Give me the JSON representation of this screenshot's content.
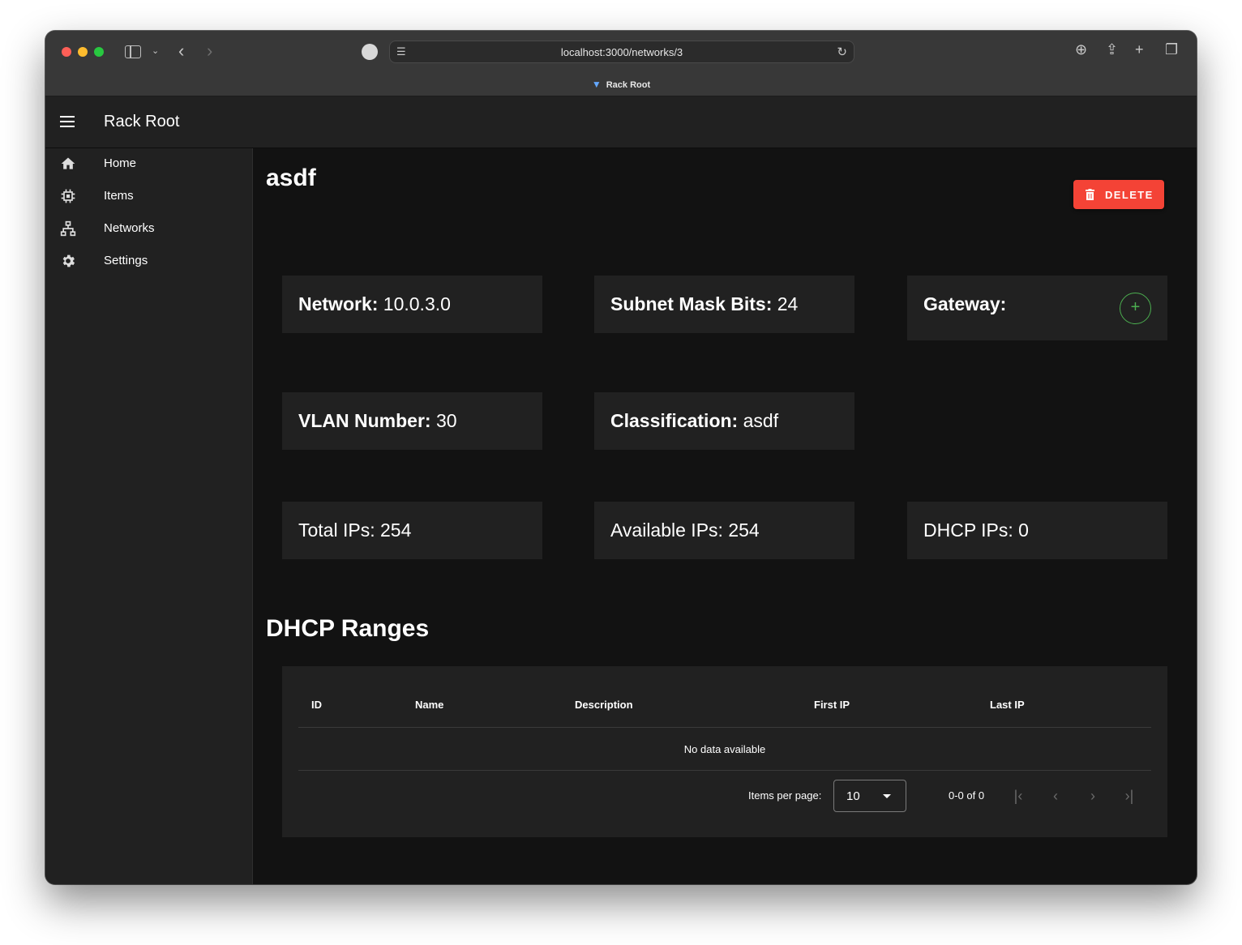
{
  "browser": {
    "url": "localhost:3000/networks/3",
    "tab_title": "Rack Root"
  },
  "appbar": {
    "title": "Rack Root"
  },
  "drawer": {
    "items": [
      {
        "label": "Home",
        "icon": "home-icon"
      },
      {
        "label": "Items",
        "icon": "chip-icon"
      },
      {
        "label": "Networks",
        "icon": "network-icon"
      },
      {
        "label": "Settings",
        "icon": "gear-icon"
      }
    ]
  },
  "page": {
    "title": "asdf",
    "delete_label": "DELETE",
    "cards": {
      "network": {
        "label": "Network:",
        "value": "10.0.3.0"
      },
      "subnet": {
        "label": "Subnet Mask Bits:",
        "value": "24"
      },
      "gateway": {
        "label": "Gateway:",
        "value": ""
      },
      "vlan": {
        "label": "VLAN Number:",
        "value": "30"
      },
      "classification": {
        "label": "Classification:",
        "value": "asdf"
      },
      "total_ips": "Total IPs: 254",
      "available_ips": "Available IPs: 254",
      "dhcp_ips": "DHCP IPs: 0"
    },
    "dhcp": {
      "heading": "DHCP Ranges",
      "columns": [
        "ID",
        "Name",
        "Description",
        "First IP",
        "Last IP"
      ],
      "empty_text": "No data available",
      "items_per_page_label": "Items per page:",
      "items_per_page": "10",
      "range_text": "0-0 of 0"
    }
  },
  "colors": {
    "accent_delete": "#f44336",
    "accent_add": "#4caf50",
    "background": "#121212",
    "surface": "#212121"
  }
}
